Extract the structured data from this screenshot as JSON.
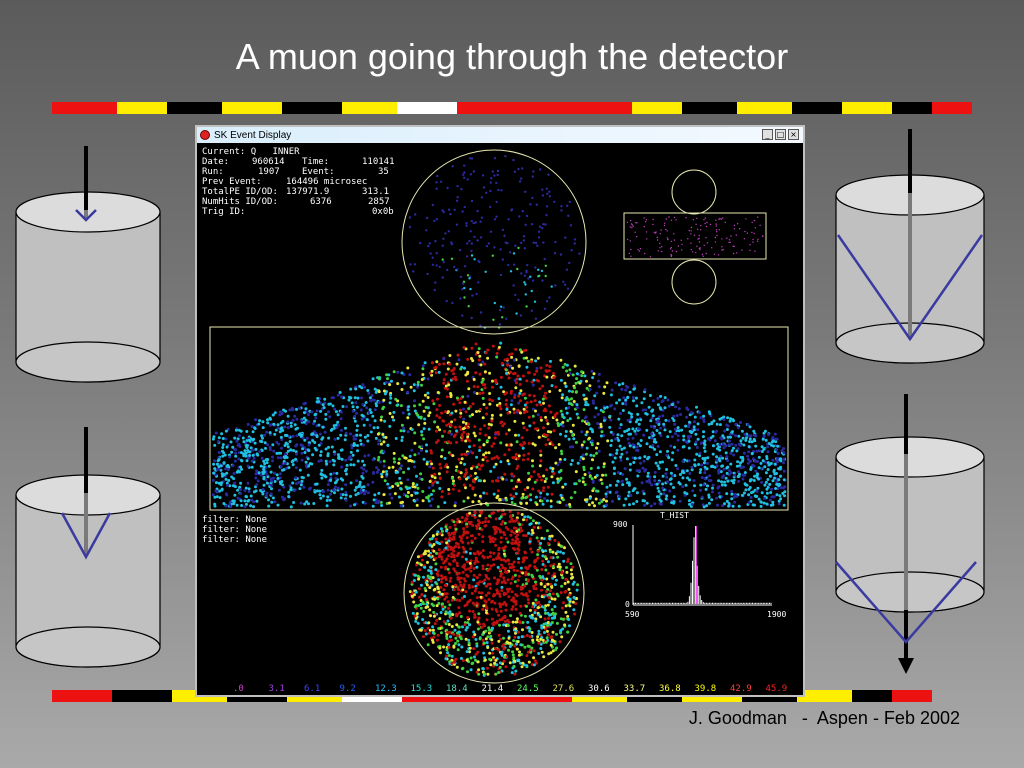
{
  "slide": {
    "title": "A muon going through the detector",
    "footer": "J. Goodman   -  Aspen - Feb 2002"
  },
  "window": {
    "title": "SK Event Display",
    "controls": [
      "_",
      "□",
      "×"
    ]
  },
  "event_info": [
    {
      "label": "Current:",
      "value": "Q   INNER"
    },
    {
      "label": "Date:",
      "value": "960614",
      "label2": "Time:",
      "value2": "110141"
    },
    {
      "label": "Run:",
      "value": "1907",
      "label2": "Event:",
      "value2": "35"
    },
    {
      "label": "Prev Event:",
      "value": "164496 microsec"
    },
    {
      "label": "TotalPE ID/OD:",
      "value": "137971.9",
      "value2": "313.1"
    },
    {
      "label": "NumHits ID/OD:",
      "value": "6376",
      "value2": "2857"
    },
    {
      "label": "Trig ID:",
      "value": "",
      "value2": "0x0b"
    }
  ],
  "filters": [
    "filter: None",
    "filter: None",
    "filter: None"
  ],
  "histogram": {
    "title": "T_HIST",
    "y_max_label": "900",
    "y_min_label": "0",
    "x_min_label": "590",
    "x_max_label": "1900",
    "peak_fraction": 0.45
  },
  "color_scale": [
    {
      "label": ".0",
      "color": "#d040d0"
    },
    {
      "label": "3.1",
      "color": "#a040e0"
    },
    {
      "label": "6.1",
      "color": "#4040ff"
    },
    {
      "label": "9.2",
      "color": "#2060ff"
    },
    {
      "label": "12.3",
      "color": "#20c0ff"
    },
    {
      "label": "15.3",
      "color": "#20e0e0"
    },
    {
      "label": "18.4",
      "color": "#60e0c0"
    },
    {
      "label": "21.4",
      "color": "#ffffff"
    },
    {
      "label": "24.5",
      "color": "#60ff60"
    },
    {
      "label": "27.6",
      "color": "#e0e060"
    },
    {
      "label": "30.6",
      "color": "#ffffff"
    },
    {
      "label": "33.7",
      "color": "#ffff80"
    },
    {
      "label": "36.8",
      "color": "#ffff40"
    },
    {
      "label": "39.8",
      "color": "#ffff00"
    },
    {
      "label": "42.9",
      "color": "#ff4040"
    },
    {
      "label": "45.9",
      "color": "#ff2020"
    }
  ],
  "colors": {
    "hit_blue": "#2a2aa0",
    "hit_cyan": "#20c0e0",
    "hit_green": "#40d040",
    "hit_yellow": "#e8e840",
    "hit_red": "#c01010",
    "outline": "#e8e8b0",
    "cone": "#3a3aa0",
    "stripe_red": "#ee1111",
    "stripe_yellow": "#ffee00",
    "stripe_black": "#000000",
    "stripe_white": "#ffffff"
  }
}
